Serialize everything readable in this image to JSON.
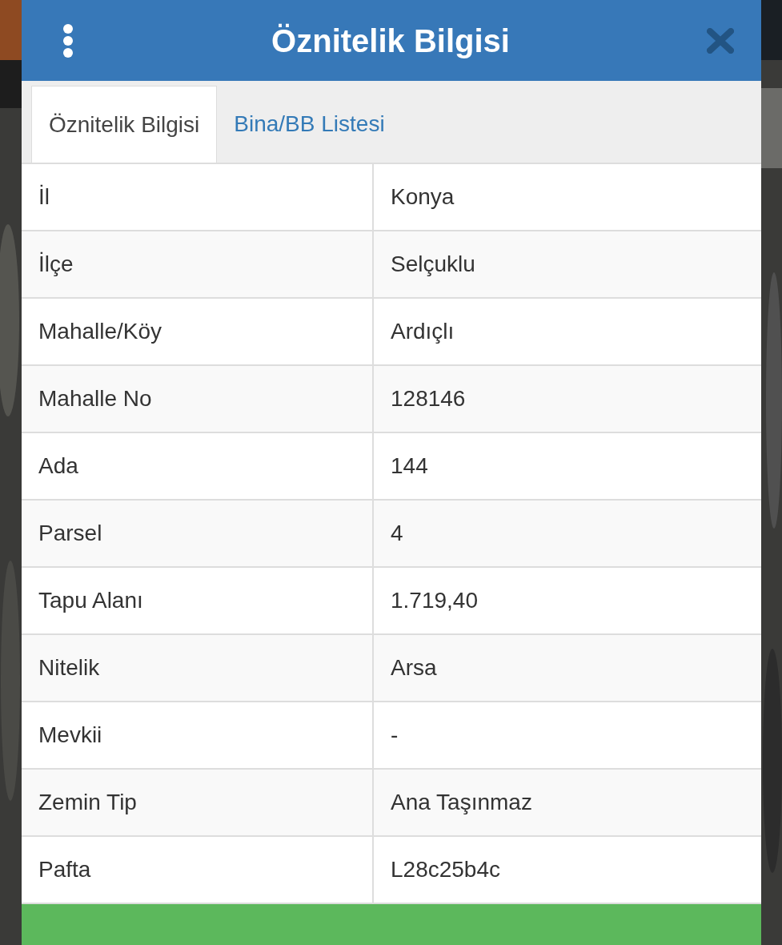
{
  "dialog": {
    "title": "Öznitelik Bilgisi"
  },
  "tabs": [
    {
      "label": "Öznitelik Bilgisi",
      "selected": true
    },
    {
      "label": "Bina/BB Listesi",
      "selected": false
    }
  ],
  "table": {
    "rows": [
      {
        "label": "İl",
        "value": "Konya"
      },
      {
        "label": "İlçe",
        "value": "Selçuklu"
      },
      {
        "label": "Mahalle/Köy",
        "value": "Ardıçlı"
      },
      {
        "label": "Mahalle No",
        "value": "128146"
      },
      {
        "label": "Ada",
        "value": "144"
      },
      {
        "label": "Parsel",
        "value": "4"
      },
      {
        "label": "Tapu Alanı",
        "value": "1.719,40"
      },
      {
        "label": "Nitelik",
        "value": "Arsa"
      },
      {
        "label": "Mevkii",
        "value": "-"
      },
      {
        "label": "Zemin Tip",
        "value": "Ana Taşınmaz"
      },
      {
        "label": "Pafta",
        "value": "L28c25b4c"
      }
    ]
  }
}
